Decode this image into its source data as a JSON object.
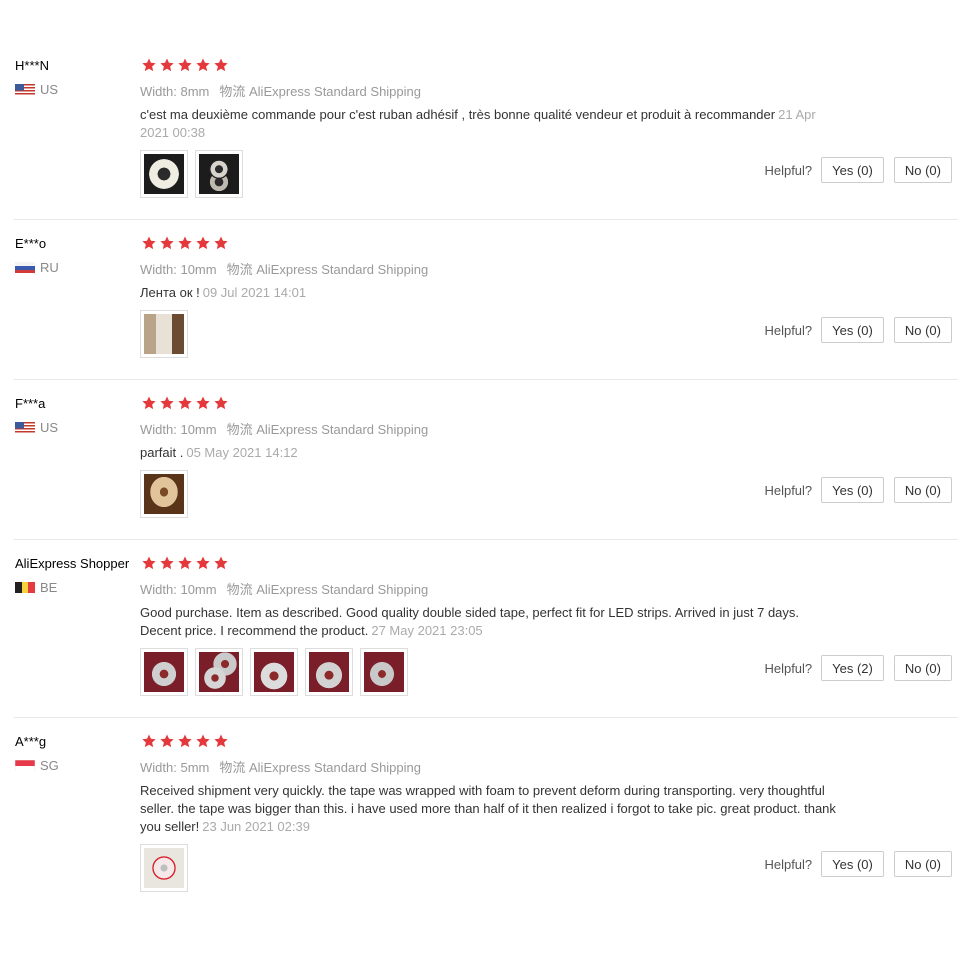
{
  "meta_labels": {
    "width_label": "Width:",
    "logistics_label": "物流",
    "helpful_label": "Helpful?"
  },
  "colors": {
    "star": "#e4393c",
    "divider": "#e8e8e8",
    "muted_text": "#999999"
  },
  "reviews": [
    {
      "author": "H***N",
      "country": "US",
      "flag": "us-flag-icon",
      "rating": 5,
      "width": "8mm",
      "shipping": "AliExpress Standard Shipping",
      "text": "c'est ma deuxième commande pour c'est ruban adhésif , très bonne qualité vendeur et produit à recommander",
      "date": "21 Apr 2021 00:38",
      "photo_count": 2,
      "yes": "Yes (0)",
      "no": "No (0)"
    },
    {
      "author": "E***o",
      "country": "RU",
      "flag": "ru-flag-icon",
      "rating": 5,
      "width": "10mm",
      "shipping": "AliExpress Standard Shipping",
      "text": "Лента ок !",
      "date": "09 Jul 2021 14:01",
      "photo_count": 1,
      "yes": "Yes (0)",
      "no": "No (0)"
    },
    {
      "author": "F***a",
      "country": "US",
      "flag": "us-flag-icon",
      "rating": 5,
      "width": "10mm",
      "shipping": "AliExpress Standard Shipping",
      "text": "parfait .",
      "date": "05 May 2021 14:12",
      "photo_count": 1,
      "yes": "Yes (0)",
      "no": "No (0)"
    },
    {
      "author": "AliExpress Shopper",
      "country": "BE",
      "flag": "be-flag-icon",
      "rating": 5,
      "width": "10mm",
      "shipping": "AliExpress Standard Shipping",
      "text": "Good purchase. Item as described. Good quality double sided tape, perfect fit for LED strips. Arrived in just 7 days. Decent price. I recommend the product.",
      "date": "27 May 2021 23:05",
      "photo_count": 5,
      "yes": "Yes (2)",
      "no": "No (0)"
    },
    {
      "author": "A***g",
      "country": "SG",
      "flag": "sg-flag-icon",
      "rating": 5,
      "width": "5mm",
      "shipping": "AliExpress Standard Shipping",
      "text": "Received shipment very quickly. the tape was wrapped with foam to prevent deform during transporting. very thoughtful seller. the tape was bigger than this. i have used more than half of it then realized i forgot to take pic. great product. thank you seller!",
      "date": "23 Jun 2021 02:39",
      "photo_count": 1,
      "yes": "Yes (0)",
      "no": "No (0)"
    }
  ]
}
